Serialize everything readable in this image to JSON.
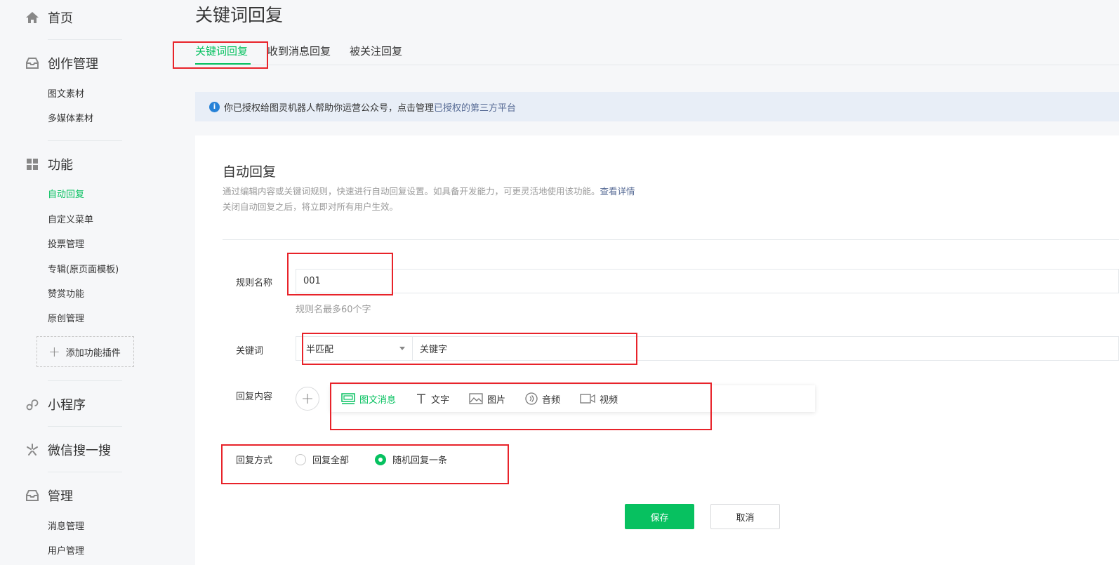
{
  "sidebar": {
    "home": "首页",
    "create": {
      "title": "创作管理",
      "items": [
        "图文素材",
        "多媒体素材"
      ]
    },
    "features": {
      "title": "功能",
      "items": [
        "自动回复",
        "自定义菜单",
        "投票管理",
        "专辑(原页面模板)",
        "赞赏功能",
        "原创管理"
      ],
      "active_index": 0
    },
    "add_plugin": "添加功能插件",
    "miniprogram": "小程序",
    "search": "微信搜一搜",
    "manage": {
      "title": "管理",
      "items": [
        "消息管理",
        "用户管理"
      ]
    }
  },
  "header": {
    "title": "关键词回复",
    "tabs": [
      "关键词回复",
      "收到消息回复",
      "被关注回复"
    ]
  },
  "notice": {
    "text": "你已授权给图灵机器人帮助你运营公众号，点击管理",
    "link": "已授权的第三方平台"
  },
  "form": {
    "section_title": "自动回复",
    "desc1": "通过编辑内容或关键词规则，快速进行自动回复设置。如具备开发能力，可更灵活地使用该功能。",
    "desc1_link": "查看详情",
    "desc2": "关闭自动回复之后，将立即对所有用户生效。",
    "rule_name_label": "规则名称",
    "rule_name_value": "001",
    "rule_name_hint": "规则名最多60个字",
    "keyword_label": "关键词",
    "match_mode": "半匹配",
    "keyword_value": "关键字",
    "reply_content_label": "回复内容",
    "media_types": [
      "图文消息",
      "文字",
      "图片",
      "音频",
      "视频"
    ],
    "reply_mode_label": "回复方式",
    "reply_modes": [
      "回复全部",
      "随机回复一条"
    ],
    "reply_mode_selected": 1,
    "save": "保存",
    "cancel": "取消"
  },
  "colors": {
    "accent": "#07c160",
    "link": "#576b95",
    "highlight": "#e8232a"
  }
}
